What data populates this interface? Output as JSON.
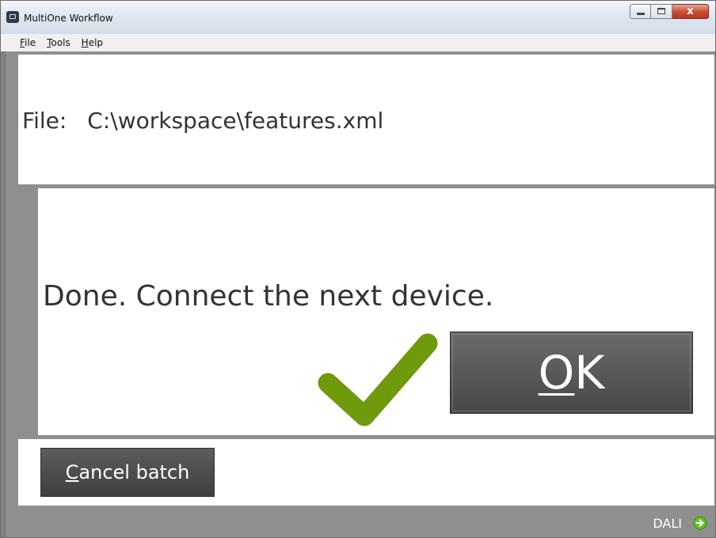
{
  "window": {
    "title": "MultiOne Workflow",
    "close_glyph": "x"
  },
  "menu": {
    "items": [
      {
        "accel": "F",
        "rest": "ile"
      },
      {
        "accel": "T",
        "rest": "ools"
      },
      {
        "accel": "H",
        "rest": "elp"
      }
    ]
  },
  "file": {
    "label": "File:",
    "path": "C:\\workspace\\features.xml"
  },
  "status": {
    "message": "Done. Connect the next device.",
    "icon": "checkmark-icon",
    "icon_color": "#6f9a0c"
  },
  "ok_button": {
    "accel": "O",
    "rest": "K"
  },
  "cancel_button": {
    "accel": "C",
    "rest": "ancel batch"
  },
  "statusbar": {
    "connection": "DALI",
    "connection_icon": "green-arrow-icon",
    "connection_icon_color": "#5fc31c"
  },
  "colors": {
    "background": "#8f8f8f",
    "panel": "#ffffff",
    "button": "#4f4f4f",
    "text": "#333333"
  }
}
